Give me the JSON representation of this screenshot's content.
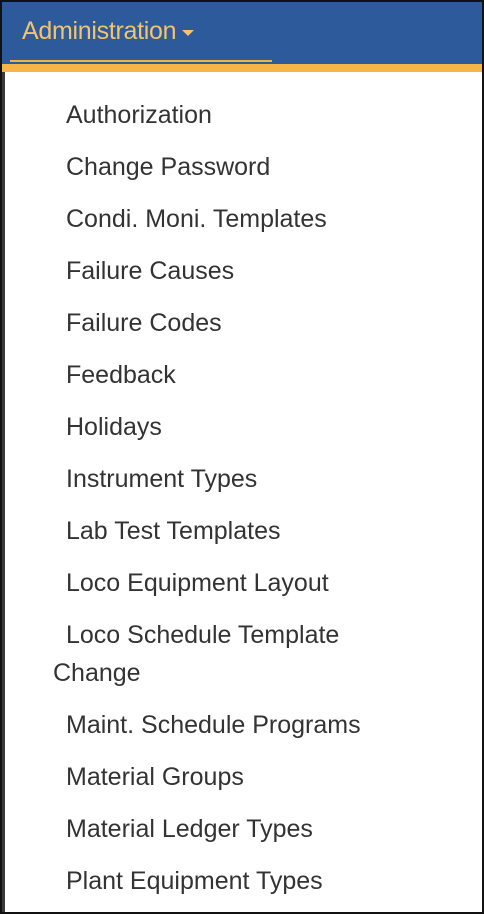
{
  "navbar": {
    "title": "Administration",
    "caret_icon": "caret-down-icon",
    "bg_color": "#2d5a9a",
    "accent_color": "#f7b548"
  },
  "menu": {
    "items": [
      "Authorization",
      "Change Password",
      "Condi. Moni. Templates",
      "Failure Causes",
      "Failure Codes",
      "Feedback",
      "Holidays",
      "Instrument Types",
      "Lab Test Templates",
      "Loco Equipment Layout",
      "Loco Schedule Template",
      "Change",
      "Maint. Schedule Programs",
      "Material Groups",
      "Material Ledger Types",
      "Plant Equipment Types"
    ]
  }
}
